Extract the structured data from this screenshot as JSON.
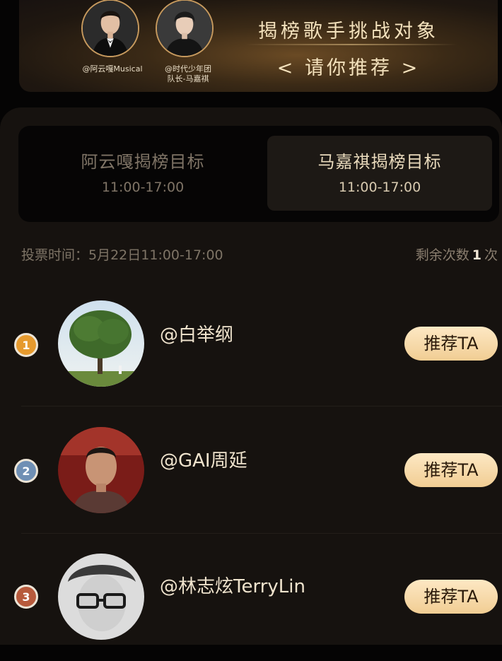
{
  "banner": {
    "stars": [
      {
        "caption_line1": "@阿云嘎Musical",
        "caption_line2": ""
      },
      {
        "caption_line1": "@时代少年团",
        "caption_line2": "队长-马嘉祺"
      }
    ],
    "title": "揭榜歌手挑战对象",
    "subtitle": "< 请你推荐 >"
  },
  "tabs": [
    {
      "title": "阿云嘎揭榜目标",
      "time": "11:00-17:00",
      "active": false
    },
    {
      "title": "马嘉祺揭榜目标",
      "time": "11:00-17:00",
      "active": true
    }
  ],
  "vote_time": "投票时间：5月22日11:00-17:00",
  "remaining": {
    "label": "剩余次数",
    "count": "1",
    "unit": "次"
  },
  "candidates": [
    {
      "rank": "1",
      "name": "@白举纲",
      "button": "推荐TA",
      "rank_color": "#e69a2e"
    },
    {
      "rank": "2",
      "name": "@GAI周延",
      "button": "推荐TA",
      "rank_color": "#6f8fb4"
    },
    {
      "rank": "3",
      "name": "@林志炫TerryLin",
      "button": "推荐TA",
      "rank_color": "#b75a3c"
    }
  ],
  "colors": {
    "accent": "#f1cd93",
    "background": "#050404",
    "panel": "#16120f"
  }
}
